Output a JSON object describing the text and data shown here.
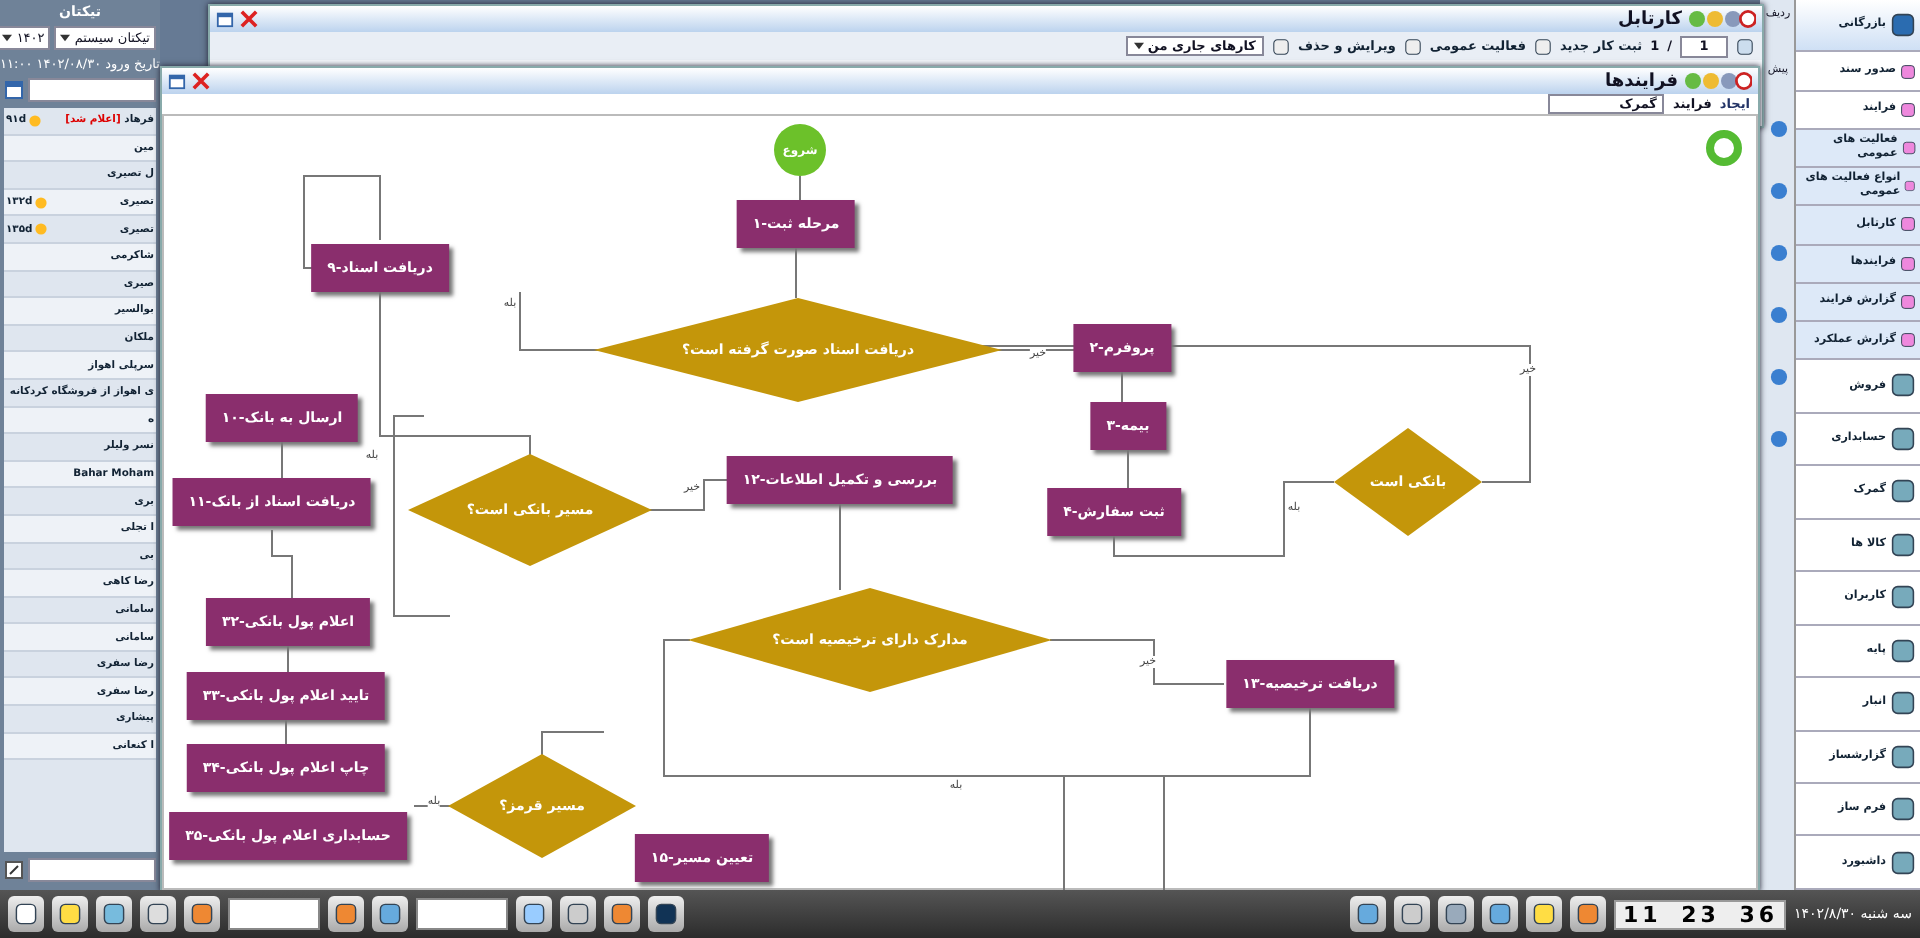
{
  "left_panel": {
    "title": "تیکتان",
    "selects": [
      "تیکتان سیستم",
      "۱۴۰۲"
    ],
    "date": "تاریخ ورود ۱۴۰۲/۰۸/۳۰ ۱۱:۰۰",
    "rows": [
      {
        "name": "فرهاد",
        "tag": "[اعلام شد]",
        "days": "۹۱d"
      },
      {
        "name": "مین"
      },
      {
        "name": "ل تصیری"
      },
      {
        "name": "تصیری",
        "days": "۱۳۲d"
      },
      {
        "name": "تصیری",
        "days": "۱۳۵d"
      },
      {
        "name": "شاکرمی"
      },
      {
        "name": "صیری"
      },
      {
        "name": "بوالسیر"
      },
      {
        "name": "ملکان"
      },
      {
        "name": "سرپلی اهواز"
      },
      {
        "name": "ی اهواز از فروشگاه کردکانه"
      },
      {
        "name": "ه"
      },
      {
        "name": "نسر ولیلر"
      },
      {
        "name": "Bahar Moham"
      },
      {
        "name": "بری"
      },
      {
        "name": "ا تجلی"
      },
      {
        "name": "بی"
      },
      {
        "name": "رضا کاهی"
      },
      {
        "name": "سامانی"
      },
      {
        "name": "سامانی"
      },
      {
        "name": "رضا سفری"
      },
      {
        "name": "رضا سفری"
      },
      {
        "name": "پیشاری"
      },
      {
        "name": "ا کنعانی"
      }
    ]
  },
  "back_window": {
    "title": "کارتابل",
    "page": "1",
    "page_sep": "/",
    "page_total": "1",
    "buttons": [
      "ثبت کار جدید",
      "فعالیت عمومی",
      "ویرایش و حذف"
    ],
    "filter": "کارهای جاری من",
    "strip_labels": [
      "ردیف",
      "پیش"
    ]
  },
  "process_window": {
    "title": "فرایندها",
    "tab": "ایجاد",
    "field_label": "فرایند",
    "field_value": "گمرک",
    "nodes": [
      {
        "kind": "start",
        "label": "شروع"
      },
      {
        "kind": "step",
        "label": "مرحله ثبت-۱"
      },
      {
        "kind": "step",
        "label": "دریافت اسناد-۹"
      },
      {
        "kind": "step",
        "label": "پروفرم-۲"
      },
      {
        "kind": "decision",
        "label": "دریافت اسناد صورت گرفته است؟"
      },
      {
        "kind": "step",
        "label": "بیمه-۳"
      },
      {
        "kind": "step",
        "label": "ثبت سفارش-۴"
      },
      {
        "kind": "decision",
        "label": "بانکی است"
      },
      {
        "kind": "step",
        "label": "ارسال به بانک-۱۰"
      },
      {
        "kind": "step",
        "label": "دریافت اسناد از بانک-۱۱"
      },
      {
        "kind": "decision",
        "label": "مسیر بانکی است؟"
      },
      {
        "kind": "step",
        "label": "بررسی و تکمیل اطلاعات-۱۲"
      },
      {
        "kind": "decision",
        "label": "مدارک دارای ترخیصیه است؟"
      },
      {
        "kind": "step",
        "label": "دریافت ترخیصیه-۱۳"
      },
      {
        "kind": "step",
        "label": "اعلام پول بانکی-۳۲"
      },
      {
        "kind": "step",
        "label": "تایید اعلام پول بانکی-۳۳"
      },
      {
        "kind": "step",
        "label": "چاپ اعلام پول بانکی-۳۴"
      },
      {
        "kind": "decision",
        "label": "مسیر قرمز؟"
      },
      {
        "kind": "step",
        "label": "تعیین مسیر-۱۵"
      },
      {
        "kind": "step",
        "label": "حسابداری اعلام پول بانکی-۳۵"
      }
    ],
    "edge_labels": [
      "بله",
      "خیر",
      "خیر",
      "بله",
      "خیر",
      "بله",
      "خیر",
      "بله",
      "بله"
    ]
  },
  "sidebar": {
    "items": [
      {
        "kind": "header",
        "label": "بازرگانی"
      },
      {
        "kind": "link",
        "label": "صدور سند"
      },
      {
        "kind": "link",
        "label": "فرایند"
      },
      {
        "kind": "sub",
        "label": "فعالیت های عمومی"
      },
      {
        "kind": "sub",
        "label": "انواع فعالیت های عمومی"
      },
      {
        "kind": "sub",
        "label": "کارتابل"
      },
      {
        "kind": "sub",
        "label": "فرایندها"
      },
      {
        "kind": "sub",
        "label": "گزارش فرایند"
      },
      {
        "kind": "sub",
        "label": "گزارش عملکرد"
      },
      {
        "kind": "module",
        "label": "فروش"
      },
      {
        "kind": "module",
        "label": "حسابداری"
      },
      {
        "kind": "module",
        "label": "گمرک"
      },
      {
        "kind": "module",
        "label": "کالا ها"
      },
      {
        "kind": "module",
        "label": "کاربران"
      },
      {
        "kind": "module",
        "label": "پایه"
      },
      {
        "kind": "module",
        "label": "انبار"
      },
      {
        "kind": "module",
        "label": "گزارشساز"
      },
      {
        "kind": "module",
        "label": "فرم ساز"
      },
      {
        "kind": "module",
        "label": "داشبورد"
      }
    ]
  },
  "taskbar": {
    "date": "سه شنبه ۱۴۰۲/۸/۳۰",
    "time": "11 23 36"
  }
}
